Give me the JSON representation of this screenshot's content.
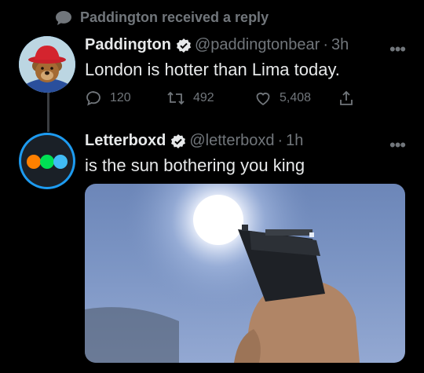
{
  "context": {
    "text": "Paddington received a reply",
    "icon": "speech-bubble-icon"
  },
  "tweet1": {
    "name": "Paddington",
    "handle": "@paddingtonbear",
    "time": "3h",
    "text": "London is hotter than Lima today.",
    "replies": "120",
    "retweets": "492",
    "likes": "5,408"
  },
  "tweet2": {
    "name": "Letterboxd",
    "handle": "@letterboxd",
    "time": "1h",
    "text": "is the sun bothering you king",
    "logo_colors": [
      "#ff8000",
      "#00e054",
      "#40bcf4"
    ]
  },
  "more_label": "•••",
  "separator": "·",
  "colors": {
    "background": "#000000",
    "accent": "#1d9bf0",
    "muted": "#71767b",
    "text": "#e7e9ea"
  }
}
